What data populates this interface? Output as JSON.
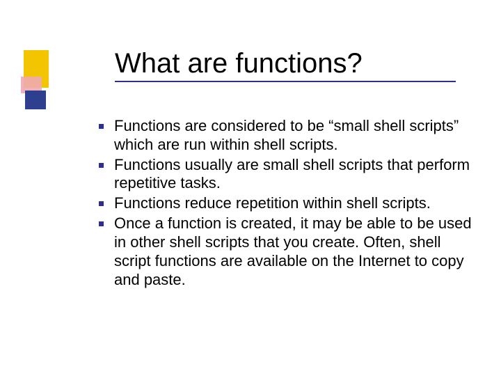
{
  "title": "What are functions?",
  "bullets": {
    "b0": "Functions are considered to be “small shell scripts” which are run within shell scripts.",
    "b1": "Functions usually are small shell scripts that perform repetitive tasks.",
    "b2": "Functions reduce repetition within shell scripts.",
    "b3": "Once a function is created, it may be able to be used in other shell scripts that you create. Often, shell script functions are available on the Internet to copy and paste."
  }
}
